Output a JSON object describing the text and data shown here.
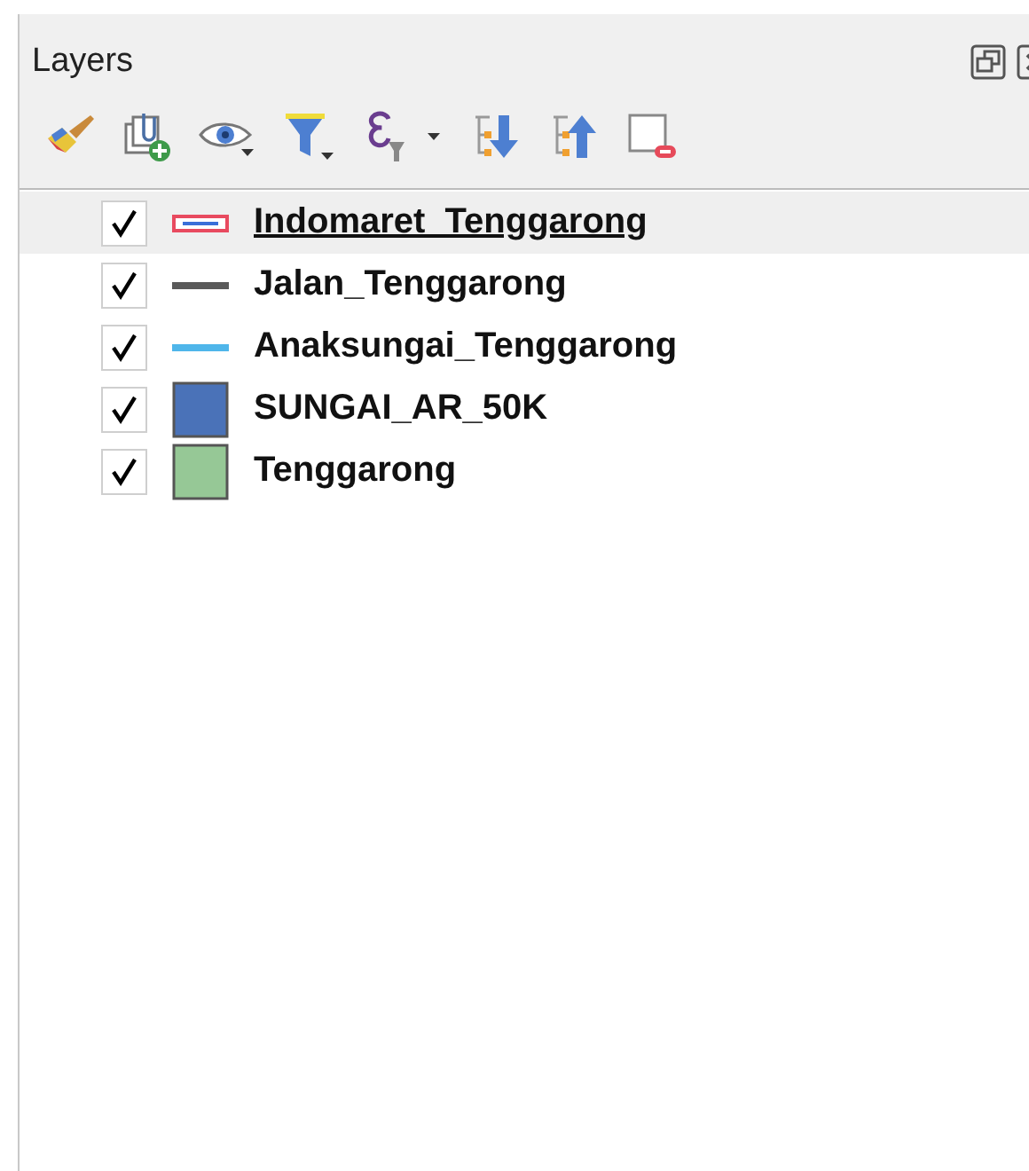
{
  "panel": {
    "title": "Layers"
  },
  "layers": [
    {
      "name": "Indomaret_Tenggarong",
      "checked": true,
      "selected": true,
      "kind": "marker",
      "color": "#e84a5f"
    },
    {
      "name": "Jalan_Tenggarong",
      "checked": true,
      "selected": false,
      "kind": "line",
      "color": "#5a5a5a"
    },
    {
      "name": "Anaksungai_Tenggarong",
      "checked": true,
      "selected": false,
      "kind": "line",
      "color": "#4fb6ea"
    },
    {
      "name": "SUNGAI_AR_50K",
      "checked": true,
      "selected": false,
      "kind": "fill",
      "color": "#4a72b8"
    },
    {
      "name": "Tenggarong",
      "checked": true,
      "selected": false,
      "kind": "fill",
      "color": "#96c896"
    }
  ]
}
